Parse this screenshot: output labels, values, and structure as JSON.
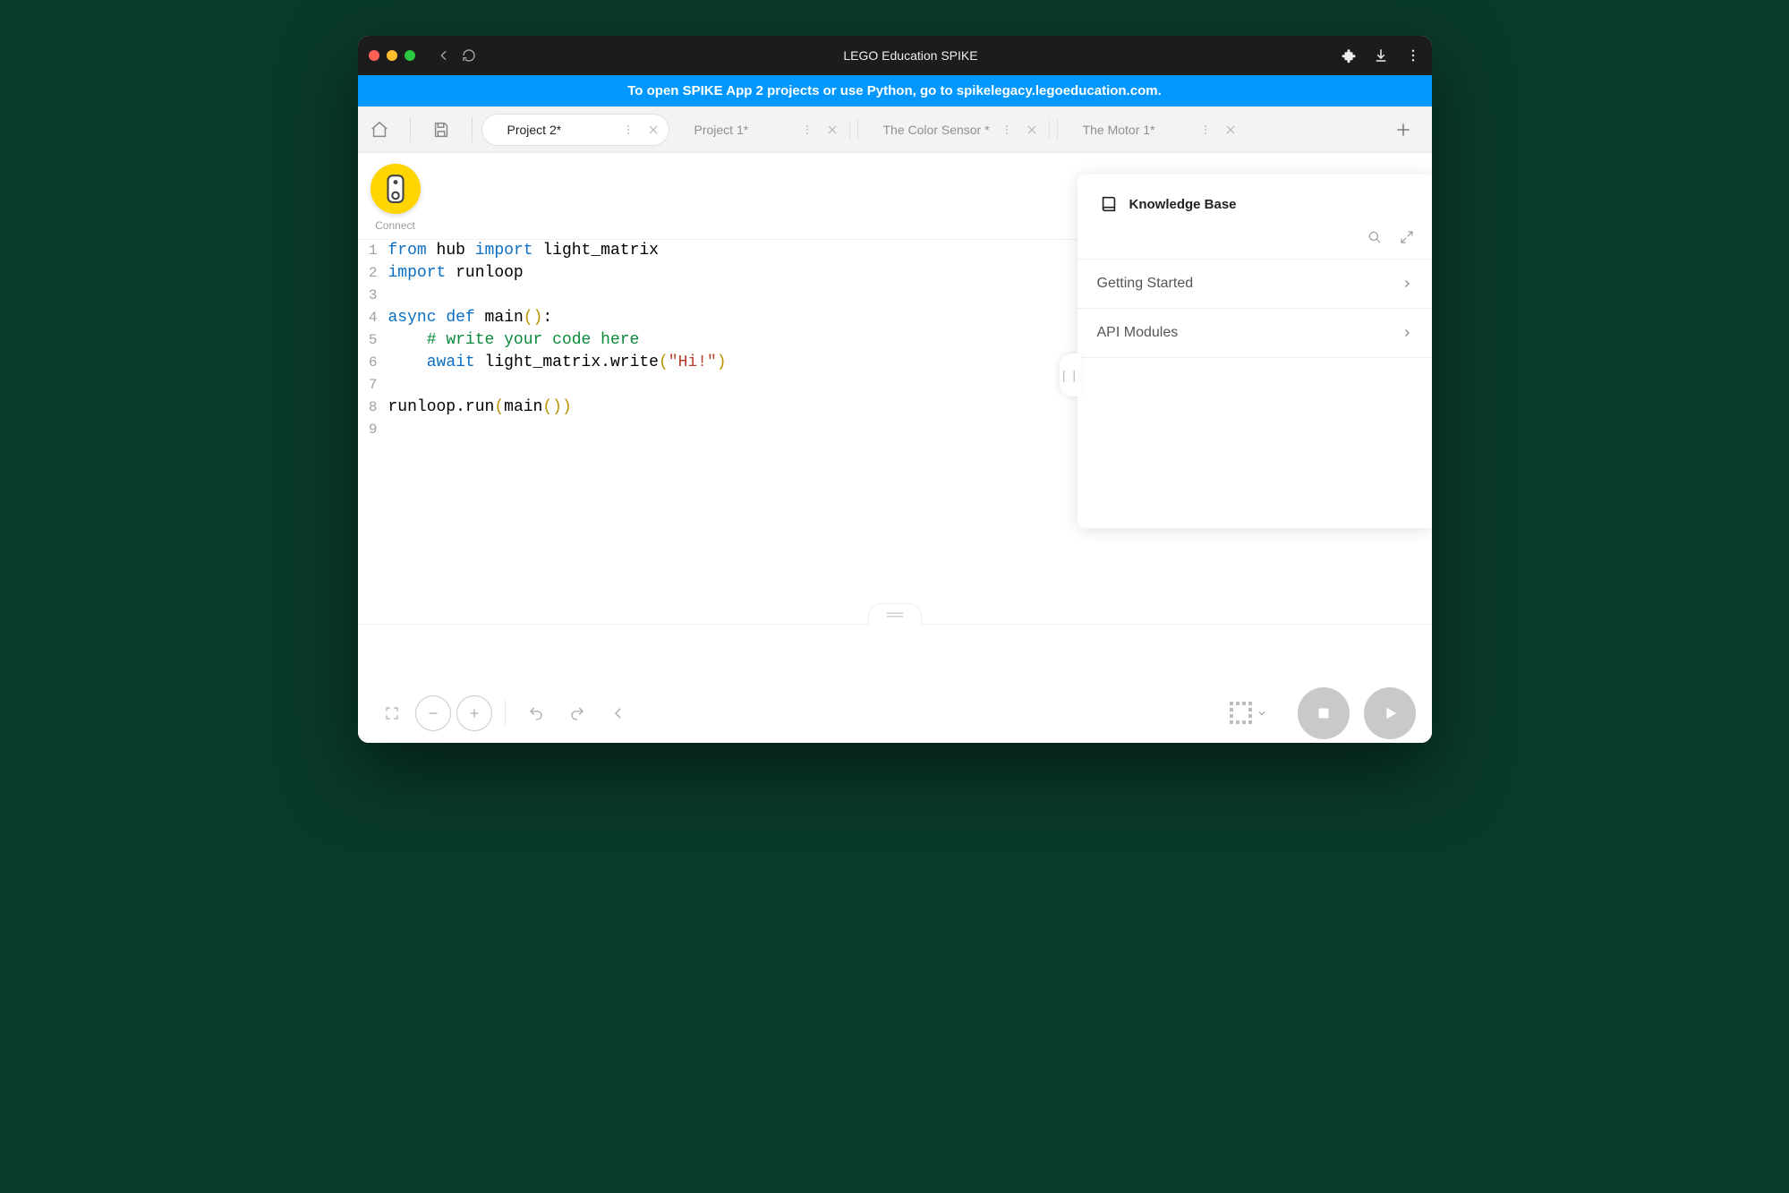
{
  "titlebar": {
    "title": "LEGO Education SPIKE"
  },
  "banner": {
    "text": "To open SPIKE App 2 projects or use Python, go to spikelegacy.legoeducation.com."
  },
  "tabs": [
    {
      "label": "Project 2*",
      "active": true
    },
    {
      "label": "Project 1*",
      "active": false
    },
    {
      "label": "The Color Sensor *",
      "active": false
    },
    {
      "label": "The Motor 1*",
      "active": false
    }
  ],
  "connect": {
    "label": "Connect"
  },
  "code": {
    "lines": [
      {
        "n": 1,
        "tokens": [
          [
            "kw",
            "from"
          ],
          [
            "",
            " hub "
          ],
          [
            "kw",
            "import"
          ],
          [
            "",
            " light_matrix"
          ]
        ]
      },
      {
        "n": 2,
        "tokens": [
          [
            "kw",
            "import"
          ],
          [
            "",
            " runloop"
          ]
        ]
      },
      {
        "n": 3,
        "tokens": [
          [
            "",
            ""
          ]
        ]
      },
      {
        "n": 4,
        "tokens": [
          [
            "kw",
            "async"
          ],
          [
            "",
            " "
          ],
          [
            "kw",
            "def"
          ],
          [
            "",
            " main"
          ],
          [
            "yel",
            "("
          ],
          [
            "yel",
            ")"
          ],
          [
            "",
            ":"
          ]
        ]
      },
      {
        "n": 5,
        "tokens": [
          [
            "",
            "    "
          ],
          [
            "cmt",
            "# write your code here"
          ]
        ]
      },
      {
        "n": 6,
        "tokens": [
          [
            "",
            "    "
          ],
          [
            "kw",
            "await"
          ],
          [
            "",
            " light_matrix.write"
          ],
          [
            "yel",
            "("
          ],
          [
            "str",
            "\"Hi!\""
          ],
          [
            "yel",
            ")"
          ]
        ]
      },
      {
        "n": 7,
        "tokens": [
          [
            "",
            ""
          ]
        ]
      },
      {
        "n": 8,
        "tokens": [
          [
            "",
            "runloop.run"
          ],
          [
            "yel",
            "("
          ],
          [
            "",
            "main"
          ],
          [
            "yel",
            "("
          ],
          [
            "yel",
            ")"
          ],
          [
            "yel",
            ")"
          ]
        ]
      },
      {
        "n": 9,
        "tokens": [
          [
            "",
            ""
          ]
        ]
      }
    ]
  },
  "kb": {
    "title": "Knowledge Base",
    "items": [
      {
        "label": "Getting Started"
      },
      {
        "label": "API Modules"
      }
    ]
  }
}
